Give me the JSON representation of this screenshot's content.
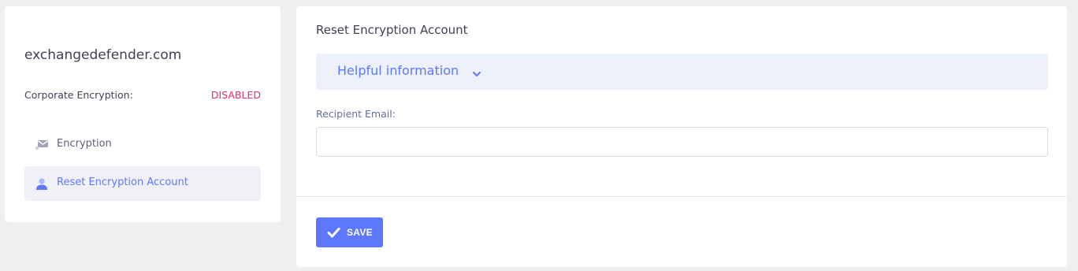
{
  "sidebar": {
    "domain": "exchangedefender.com",
    "encryption_label": "Corporate Encryption:",
    "encryption_status": "DISABLED",
    "status_color": "#e32d6b",
    "items": [
      {
        "label": "Encryption",
        "icon": "envelope-icon",
        "active": false
      },
      {
        "label": "Reset Encryption Account",
        "icon": "user-icon",
        "active": true
      }
    ]
  },
  "main": {
    "title": "Reset Encryption Account",
    "helpful": {
      "label": "Helpful information",
      "icon": "chevron-down-icon"
    },
    "recipient_email": {
      "label": "Recipient Email:",
      "value": "",
      "placeholder": ""
    },
    "save_button": {
      "label": "SAVE",
      "icon": "check-icon"
    }
  },
  "colors": {
    "accent": "#5d78ff",
    "background": "#efefef",
    "card": "#ffffff",
    "info_bar": "#edf1fb"
  }
}
